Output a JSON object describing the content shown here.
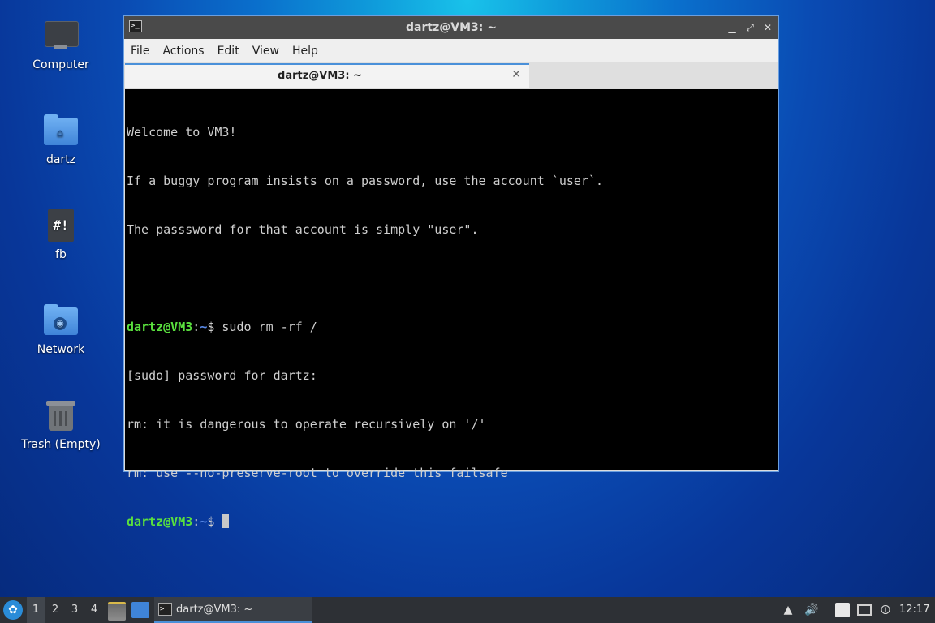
{
  "desktop": {
    "icons": [
      {
        "label": "Computer"
      },
      {
        "label": "dartz"
      },
      {
        "label": "fb",
        "glyph": "#!"
      },
      {
        "label": "Network"
      },
      {
        "label": "Trash (Empty)"
      }
    ]
  },
  "window": {
    "title": "dartz@VM3: ~",
    "menu": [
      "File",
      "Actions",
      "Edit",
      "View",
      "Help"
    ],
    "tab_label": "dartz@VM3: ~",
    "buttons": {
      "minimize": "˙",
      "maximize": "⤢",
      "close": "✕"
    }
  },
  "terminal": {
    "lines": [
      "Welcome to VM3!",
      "If a buggy program insists on a password, use the account `user`.",
      "The passsword for that account is simply \"user\"."
    ],
    "prompt_user": "dartz@VM3",
    "prompt_sep": ":",
    "prompt_path": "~",
    "prompt_sigil": "$ ",
    "command": "sudo rm -rf /",
    "output": [
      "[sudo] password for dartz:",
      "rm: it is dangerous to operate recursively on '/'",
      "rm: use --no-preserve-root to override this failsafe"
    ]
  },
  "taskbar": {
    "workspaces": [
      "1",
      "2",
      "3",
      "4"
    ],
    "active_workspace": "1",
    "task_label": "dartz@VM3: ~",
    "clock": "12:17",
    "tray_icons": [
      "network-upload-icon",
      "volume-icon",
      "clipboard-icon",
      "network-icon",
      "notification-icon"
    ]
  },
  "colors": {
    "prompt_user": "#5ae03e",
    "prompt_path": "#5a8ae8",
    "accent": "#4a90d9"
  }
}
